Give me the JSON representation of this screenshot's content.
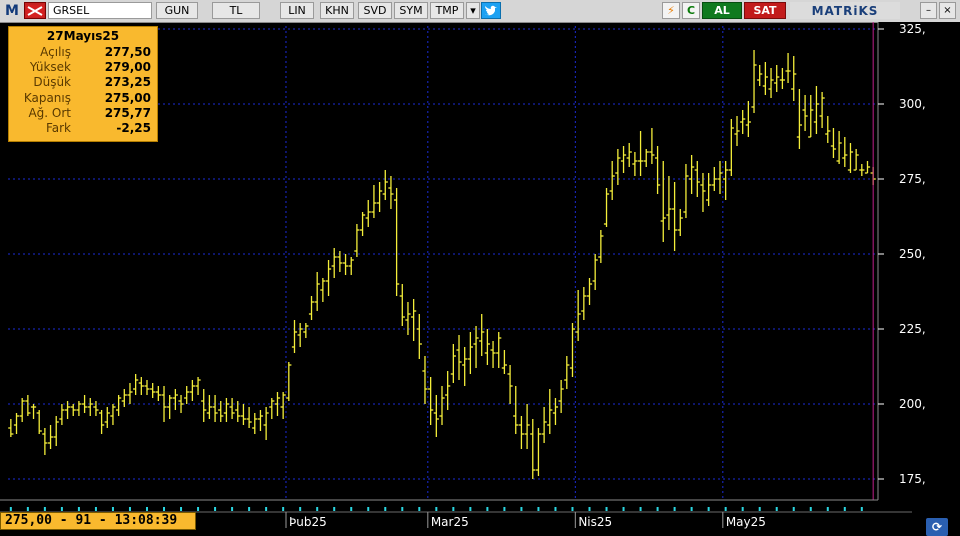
{
  "toolbar": {
    "logo": "M",
    "symbol": "GRSEL",
    "period": "GUN",
    "currency": "TL",
    "scale": "LIN",
    "khn": "KHN",
    "svd": "SVD",
    "sym": "SYM",
    "tmp": "TMP",
    "lightning_icon": "⚡",
    "refresh_icon": "C",
    "buy": "AL",
    "sell": "SAT",
    "brand": "MATRiKS",
    "minimize": "–",
    "close": "×"
  },
  "info": {
    "date": "27Mayıs25",
    "rows": [
      {
        "label": "Açılış",
        "value": "277,50"
      },
      {
        "label": "Yüksek",
        "value": "279,00"
      },
      {
        "label": "Düşük",
        "value": "273,25"
      },
      {
        "label": "Kapanış",
        "value": "275,00"
      },
      {
        "label": "Ağ. Ort",
        "value": "275,77"
      },
      {
        "label": "Fark",
        "value": "-2,25"
      }
    ]
  },
  "status": {
    "text": "275,00 - 91 - 13:08:39"
  },
  "colors": {
    "bars": "#f4ee3a",
    "grid": "#1b2bd8",
    "axis_text": "#ffffff",
    "cursor_line": "#c0208a",
    "ticks_marker": "#2bd6e0",
    "info_bg": "#f9b92e"
  },
  "chart_data": {
    "type": "ohlc",
    "y_axis_position": "right",
    "ylim": [
      168,
      326
    ],
    "y_ticks": [
      175,
      200,
      225,
      250,
      275,
      300,
      325
    ],
    "y_tick_labels": [
      "175,",
      "200,",
      "225,",
      "250,",
      "275,",
      "300,",
      "325,"
    ],
    "x_labels": [
      {
        "label": "Þub25",
        "index": 49
      },
      {
        "label": "Mar25",
        "index": 74
      },
      {
        "label": "Nis25",
        "index": 100
      },
      {
        "label": "May25",
        "index": 126
      }
    ],
    "grid": true,
    "bars": [
      [
        192,
        195,
        189,
        190
      ],
      [
        193,
        197,
        190,
        196
      ],
      [
        196,
        202,
        194,
        201
      ],
      [
        201,
        203,
        196,
        197
      ],
      [
        199,
        200,
        195,
        199
      ],
      [
        197,
        198,
        190,
        191
      ],
      [
        190,
        192,
        183,
        187
      ],
      [
        187,
        193,
        185,
        189
      ],
      [
        189,
        196,
        186,
        194
      ],
      [
        195,
        200,
        193,
        198
      ],
      [
        198,
        201,
        195,
        199
      ],
      [
        199,
        200,
        196,
        198
      ],
      [
        198,
        201,
        196,
        200
      ],
      [
        200,
        203,
        197,
        199
      ],
      [
        199,
        202,
        196,
        200
      ],
      [
        199,
        201,
        196,
        198
      ],
      [
        197,
        198,
        190,
        193
      ],
      [
        194,
        199,
        192,
        197
      ],
      [
        196,
        200,
        193,
        199
      ],
      [
        198,
        203,
        196,
        202
      ],
      [
        201,
        205,
        199,
        203
      ],
      [
        203,
        207,
        200,
        204
      ],
      [
        205,
        210,
        203,
        208
      ],
      [
        207,
        209,
        203,
        206
      ],
      [
        206,
        208,
        203,
        205
      ],
      [
        205,
        207,
        202,
        204
      ],
      [
        204,
        206,
        201,
        203
      ],
      [
        203,
        206,
        194,
        199
      ],
      [
        199,
        203,
        195,
        202
      ],
      [
        202,
        205,
        198,
        203
      ],
      [
        201,
        203,
        197,
        200
      ],
      [
        202,
        206,
        200,
        204
      ],
      [
        204,
        208,
        201,
        206
      ],
      [
        206,
        209,
        203,
        208
      ],
      [
        201,
        205,
        194,
        198
      ],
      [
        197,
        203,
        195,
        199
      ],
      [
        199,
        203,
        194,
        197
      ],
      [
        198,
        201,
        194,
        196
      ],
      [
        197,
        202,
        194,
        200
      ],
      [
        199,
        202,
        195,
        197
      ],
      [
        198,
        201,
        194,
        196
      ],
      [
        196,
        200,
        193,
        195
      ],
      [
        195,
        199,
        192,
        194
      ],
      [
        192,
        197,
        190,
        195
      ],
      [
        195,
        198,
        191,
        196
      ],
      [
        193,
        199,
        188,
        197
      ],
      [
        199,
        202,
        195,
        201
      ],
      [
        200,
        204,
        196,
        202
      ],
      [
        199,
        204,
        195,
        203
      ],
      [
        202,
        214,
        201,
        213
      ],
      [
        219,
        228,
        217,
        224
      ],
      [
        223,
        227,
        219,
        225
      ],
      [
        224,
        227,
        222,
        226
      ],
      [
        230,
        236,
        228,
        234
      ],
      [
        234,
        244,
        231,
        240
      ],
      [
        238,
        242,
        234,
        241
      ],
      [
        241,
        248,
        236,
        245
      ],
      [
        246,
        252,
        242,
        249
      ],
      [
        249,
        251,
        244,
        247
      ],
      [
        247,
        250,
        243,
        246
      ],
      [
        246,
        249,
        243,
        248
      ],
      [
        251,
        260,
        249,
        258
      ],
      [
        258,
        264,
        256,
        263
      ],
      [
        262,
        268,
        259,
        264
      ],
      [
        264,
        273,
        262,
        267
      ],
      [
        267,
        274,
        264,
        271
      ],
      [
        270,
        278,
        268,
        274
      ],
      [
        272,
        276,
        265,
        270
      ],
      [
        268,
        272,
        236,
        240
      ],
      [
        236,
        240,
        226,
        229
      ],
      [
        228,
        234,
        223,
        230
      ],
      [
        229,
        235,
        221,
        231
      ],
      [
        225,
        230,
        215,
        220
      ],
      [
        211,
        216,
        200,
        205
      ],
      [
        205,
        209,
        193,
        198
      ],
      [
        197,
        203,
        189,
        195
      ],
      [
        196,
        206,
        193,
        202
      ],
      [
        203,
        211,
        198,
        206
      ],
      [
        210,
        220,
        207,
        216
      ],
      [
        218,
        223,
        208,
        214
      ],
      [
        213,
        219,
        206,
        215
      ],
      [
        215,
        224,
        210,
        219
      ],
      [
        220,
        226,
        212,
        222
      ],
      [
        221,
        230,
        216,
        224
      ],
      [
        217,
        225,
        213,
        220
      ],
      [
        218,
        221,
        212,
        217
      ],
      [
        217,
        224,
        212,
        222
      ],
      [
        212,
        218,
        210,
        213
      ],
      [
        210,
        213,
        200,
        206
      ],
      [
        196,
        206,
        190,
        193
      ],
      [
        193,
        196,
        185,
        190
      ],
      [
        190,
        200,
        185,
        193
      ],
      [
        190,
        195,
        175,
        178
      ],
      [
        178,
        192,
        176,
        190
      ],
      [
        190,
        199,
        187,
        194
      ],
      [
        193,
        205,
        190,
        198
      ],
      [
        197,
        202,
        193,
        199
      ],
      [
        201,
        208,
        197,
        205
      ],
      [
        208,
        216,
        205,
        213
      ],
      [
        212,
        227,
        209,
        225
      ],
      [
        224,
        238,
        221,
        230
      ],
      [
        231,
        239,
        228,
        236
      ],
      [
        236,
        242,
        233,
        240
      ],
      [
        241,
        250,
        238,
        248
      ],
      [
        249,
        258,
        247,
        256
      ],
      [
        260,
        272,
        259,
        270
      ],
      [
        271,
        281,
        268,
        276
      ],
      [
        277,
        285,
        273,
        282
      ],
      [
        281,
        286,
        277,
        283
      ],
      [
        282,
        287,
        279,
        284
      ],
      [
        280,
        284,
        276,
        281
      ],
      [
        281,
        291,
        276,
        281
      ],
      [
        281,
        285,
        279,
        284
      ],
      [
        284,
        292,
        280,
        283
      ],
      [
        282,
        286,
        270,
        273
      ],
      [
        261,
        281,
        254,
        262
      ],
      [
        263,
        276,
        258,
        265
      ],
      [
        265,
        274,
        251,
        258
      ],
      [
        258,
        265,
        256,
        262
      ],
      [
        264,
        280,
        262,
        276
      ],
      [
        275,
        283,
        270,
        279
      ],
      [
        278,
        281,
        269,
        274
      ],
      [
        273,
        277,
        264,
        271
      ],
      [
        268,
        277,
        266,
        273
      ],
      [
        273,
        279,
        271,
        275
      ],
      [
        275,
        281,
        270,
        277
      ],
      [
        275,
        281,
        268,
        278
      ],
      [
        278,
        295,
        276,
        292
      ],
      [
        290,
        296,
        286,
        291
      ],
      [
        294,
        298,
        290,
        295
      ],
      [
        293,
        301,
        289,
        294
      ],
      [
        299,
        318,
        297,
        313
      ],
      [
        308,
        313,
        306,
        310
      ],
      [
        306,
        314,
        303,
        309
      ],
      [
        305,
        312,
        302,
        308
      ],
      [
        307,
        313,
        304,
        309
      ],
      [
        308,
        312,
        305,
        308
      ],
      [
        311,
        317,
        307,
        311
      ],
      [
        305,
        316,
        301,
        310
      ],
      [
        289,
        305,
        285,
        293
      ],
      [
        298,
        303,
        291,
        296
      ],
      [
        289,
        303,
        289,
        298
      ],
      [
        294,
        306,
        290,
        300
      ],
      [
        296,
        304,
        292,
        302
      ],
      [
        290,
        296,
        287,
        291
      ],
      [
        286,
        292,
        282,
        285
      ],
      [
        281,
        291,
        280,
        287
      ],
      [
        282,
        289,
        279,
        283
      ],
      [
        278,
        287,
        277,
        284
      ],
      [
        278,
        285,
        278,
        283
      ],
      [
        278,
        280,
        276,
        278
      ],
      [
        277,
        281,
        277,
        279
      ],
      [
        277,
        279,
        273,
        275
      ]
    ]
  }
}
